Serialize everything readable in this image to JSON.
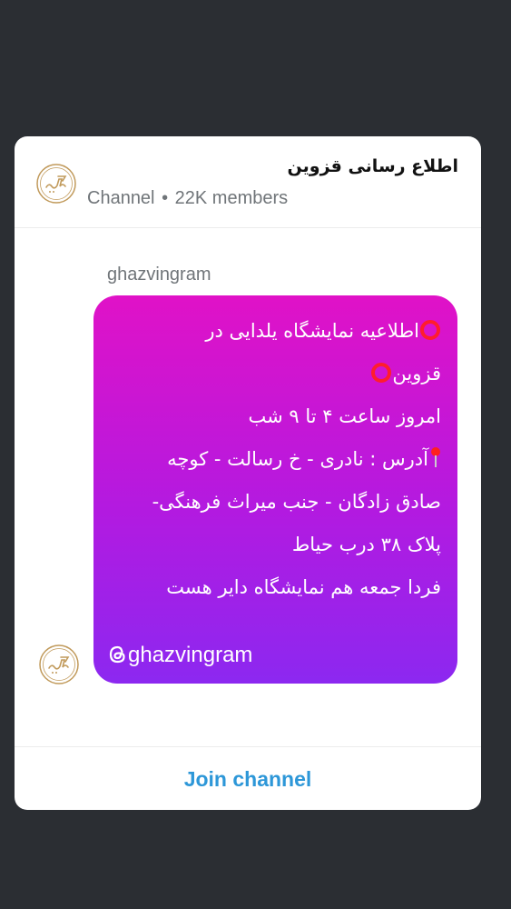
{
  "header": {
    "title": "اطلاع رسانی قزوین",
    "type_label": "Channel",
    "separator": "•",
    "members_label": "22K members",
    "avatar_icon": "ghazvingram-logo-icon"
  },
  "message": {
    "sender": "ghazvingram",
    "lines": [
      "اطلاعیه نمایشگاه یلدایی در",
      "قزوین",
      "امروز ساعت ۴ تا ۹ شب",
      "آدرس : نادری - خ رسالت - کوچه",
      "صادق زادگان - جنب میراث فرهنگی-",
      "پلاک ۳۸ درب حیاط",
      "فردا جمعه هم نمایشگاه دایر هست"
    ],
    "handle": "ghazvingram",
    "emoji": {
      "ring": "red-hollow-circle-icon",
      "pin": "round-pushpin-icon",
      "threads": "threads-logo-icon"
    },
    "avatar_icon": "ghazvingram-logo-icon"
  },
  "footer": {
    "join_label": "Join channel"
  },
  "colors": {
    "page_background": "#2b2e33",
    "card_background": "#ffffff",
    "bubble_gradient_top": "#e012c7",
    "bubble_gradient_bottom": "#8c28f0",
    "join_text": "#2d97d8",
    "meta_text": "#707579",
    "logo_gold": "#c19a5b",
    "ring_red": "#ff1d2c"
  }
}
